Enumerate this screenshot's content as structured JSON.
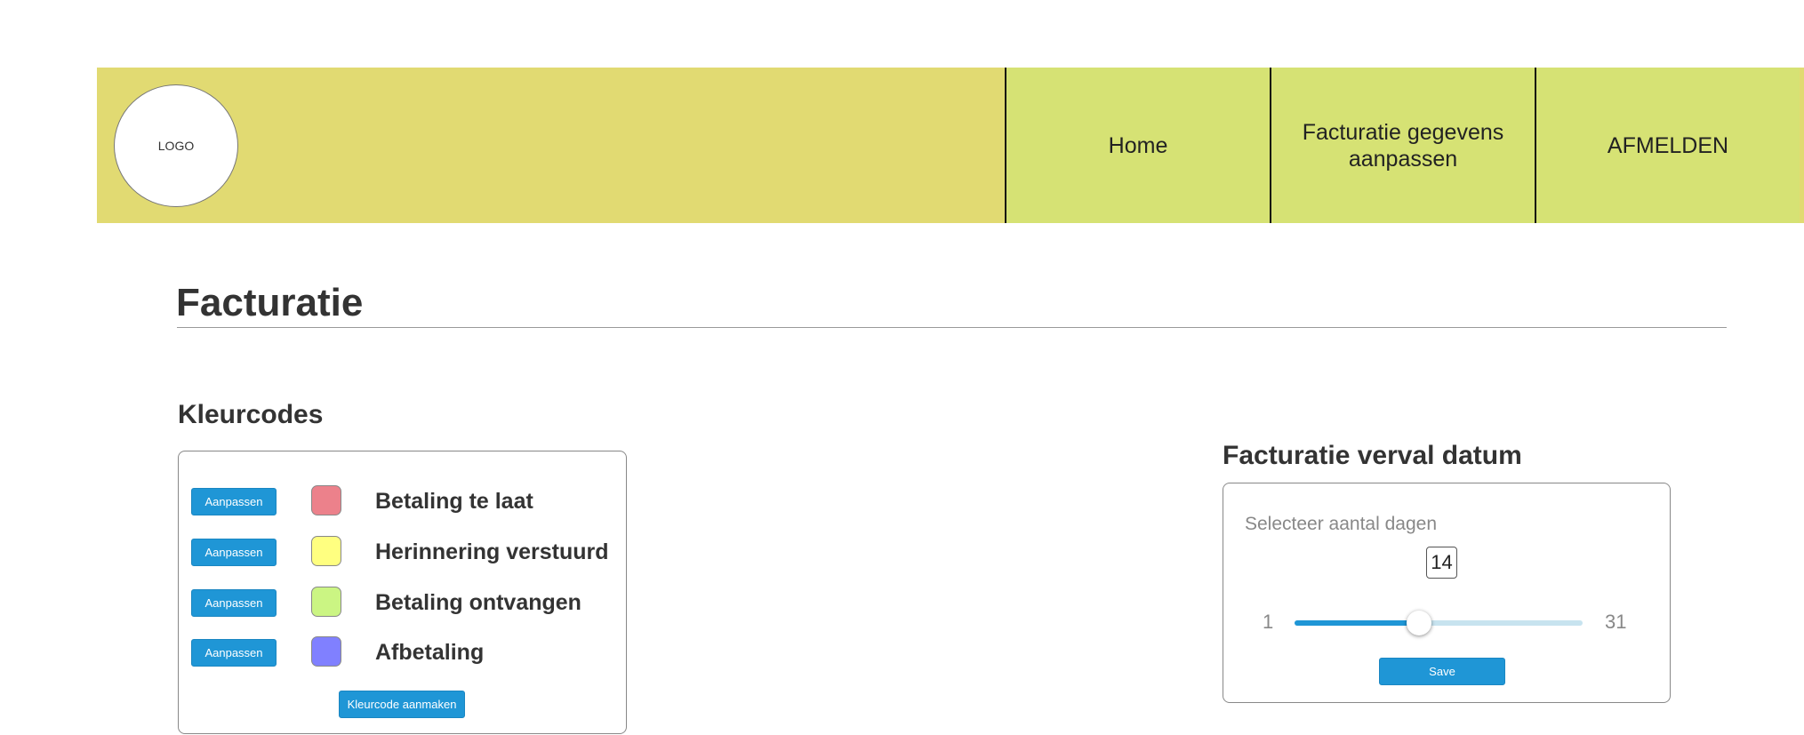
{
  "header": {
    "logo_text": "LOGO",
    "nav": [
      {
        "label": "Home"
      },
      {
        "label": "Facturatie gegevens aanpassen"
      },
      {
        "label": "AFMELDEN"
      }
    ]
  },
  "page": {
    "title": "Facturatie"
  },
  "kleurcodes": {
    "title": "Kleurcodes",
    "items": [
      {
        "button_label": "Aanpassen",
        "label": "Betaling te laat",
        "color": "#ec818b"
      },
      {
        "button_label": "Aanpassen",
        "label": "Herinnering verstuurd",
        "color": "#ffff80"
      },
      {
        "button_label": "Aanpassen",
        "label": "Betaling ontvangen",
        "color": "#cbf583"
      },
      {
        "button_label": "Aanpassen",
        "label": "Afbetaling",
        "color": "#8080ff"
      }
    ],
    "create_label": "Kleurcode aanmaken"
  },
  "verval": {
    "title": "Facturatie verval datum",
    "slider_label": "Selecteer aantal dagen",
    "value": 14,
    "min": 1,
    "max": 31,
    "save_label": "Save"
  },
  "colors": {
    "header_left": "#e1da72",
    "header_nav": "#d6e274",
    "accent": "#1f96d6"
  }
}
